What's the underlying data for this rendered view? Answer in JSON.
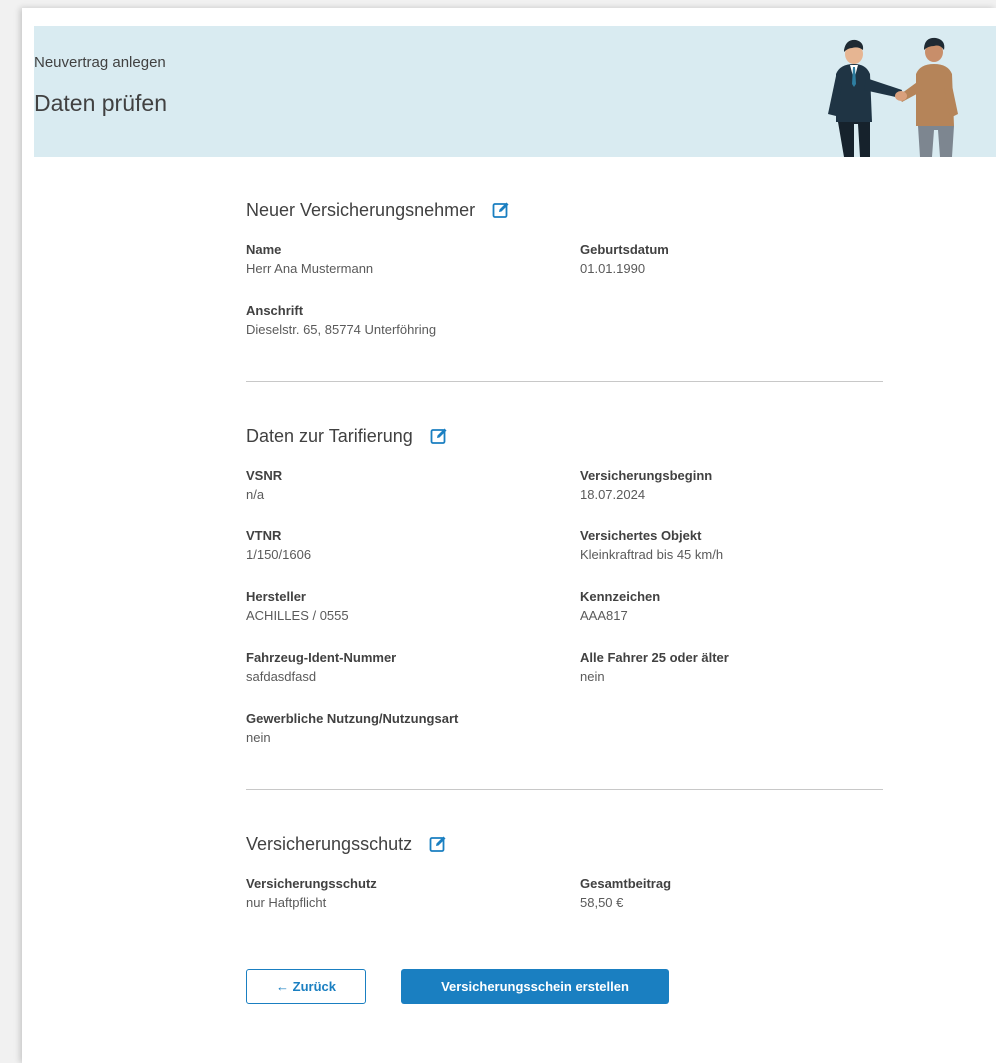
{
  "header": {
    "subtitle": "Neuvertrag anlegen",
    "title": "Daten prüfen"
  },
  "accent_color": "#1a7fc1",
  "header_bg": "#d9ebf1",
  "sections": {
    "policyholder": {
      "title": "Neuer Versicherungsnehmer",
      "name_label": "Name",
      "name_value": "Herr Ana Mustermann",
      "dob_label": "Geburtsdatum",
      "dob_value": "01.01.1990",
      "address_label": "Anschrift",
      "address_value": "Dieselstr. 65, 85774 Unterföhring"
    },
    "tariff": {
      "title": "Daten zur Tarifierung",
      "vsnr_label": "VSNR",
      "vsnr_value": "n/a",
      "start_label": "Versicherungsbeginn",
      "start_value": "18.07.2024",
      "vtnr_label": "VTNR",
      "vtnr_value": "1/150/1606",
      "object_label": "Versichertes Objekt",
      "object_value": "Kleinkraftrad bis 45 km/h",
      "maker_label": "Hersteller",
      "maker_value": "ACHILLES / 0555",
      "plate_label": "Kennzeichen",
      "plate_value": "AAA817",
      "vin_label": "Fahrzeug-Ident-Nummer",
      "vin_value": "safdasdfasd",
      "drivers_label": "Alle Fahrer 25 oder älter",
      "drivers_value": "nein",
      "commercial_label": "Gewerbliche Nutzung/Nutzungsart",
      "commercial_value": "nein"
    },
    "coverage": {
      "title": "Versicherungsschutz",
      "coverage_label": "Versicherungsschutz",
      "coverage_value": "nur Haftpflicht",
      "total_label": "Gesamtbeitrag",
      "total_value": "58,50 €"
    }
  },
  "actions": {
    "back_label": "← Zurück",
    "create_label": "Versicherungsschein erstellen"
  },
  "icons": {
    "edit": "edit-icon",
    "hero": "handshake-illustration"
  }
}
